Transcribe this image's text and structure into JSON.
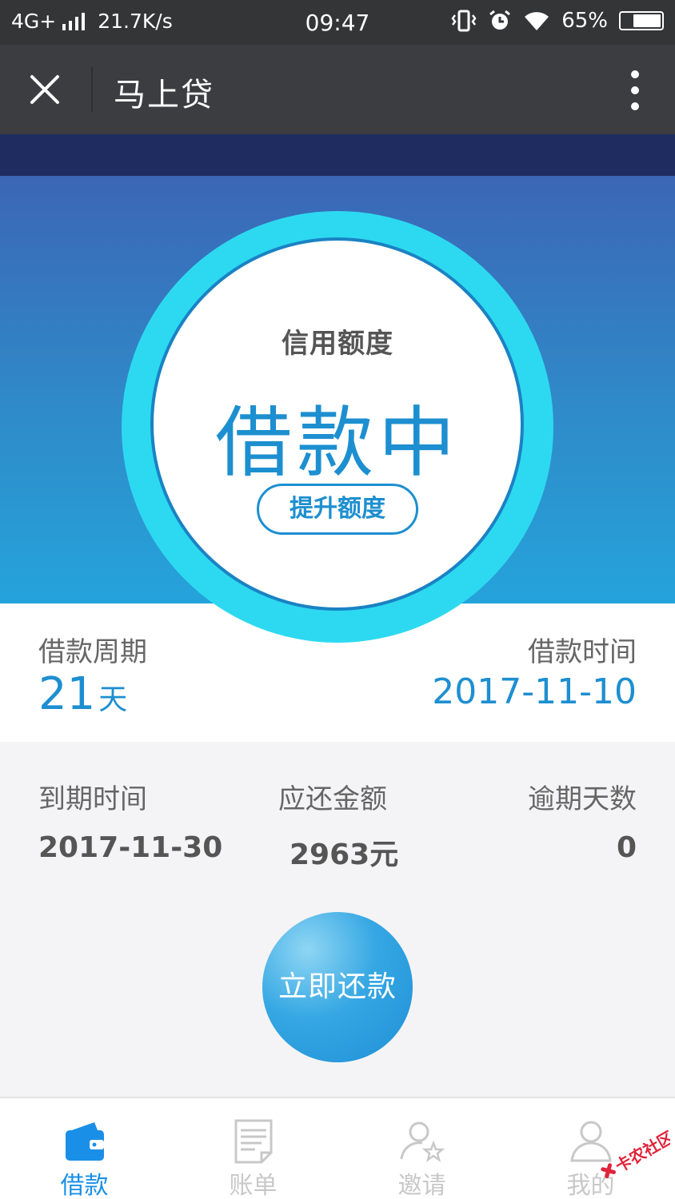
{
  "status_bar": {
    "network": "4G+",
    "speed": "21.7K/s",
    "time": "09:47",
    "battery": "65%",
    "battery_level": 0.65,
    "icons": [
      "signal-icon",
      "vibrate-icon",
      "alarm-icon",
      "wifi-icon",
      "battery-icon"
    ]
  },
  "title_bar": {
    "title": "马上贷",
    "close_icon": "close-icon",
    "more_icon": "more-vertical-icon"
  },
  "credit": {
    "label": "信用额度",
    "status": "借款中",
    "raise_button": "提升额度"
  },
  "loan": {
    "cycle_label": "借款周期",
    "cycle_value": "21",
    "cycle_unit": "天",
    "time_label": "借款时间",
    "time_value": "2017-11-10"
  },
  "details": {
    "due_label": "到期时间",
    "due_value": "2017-11-30",
    "amount_label": "应还金额",
    "amount_value": "2963元",
    "overdue_label": "逾期天数",
    "overdue_value": "0"
  },
  "repay_button": "立即还款",
  "bottom_nav": {
    "items": [
      {
        "label": "借款",
        "icon": "wallet-icon",
        "active": true
      },
      {
        "label": "账单",
        "icon": "bill-icon",
        "active": false
      },
      {
        "label": "邀请",
        "icon": "invite-icon",
        "active": false
      },
      {
        "label": "我的",
        "icon": "user-icon",
        "active": false
      }
    ]
  },
  "watermark": {
    "text": "卡农社区"
  },
  "colors": {
    "accent": "#1d8fd0",
    "nav_active": "#1a8fe8",
    "circle_outer": "#2dd9f0",
    "header_bg": "#3b3d40"
  }
}
